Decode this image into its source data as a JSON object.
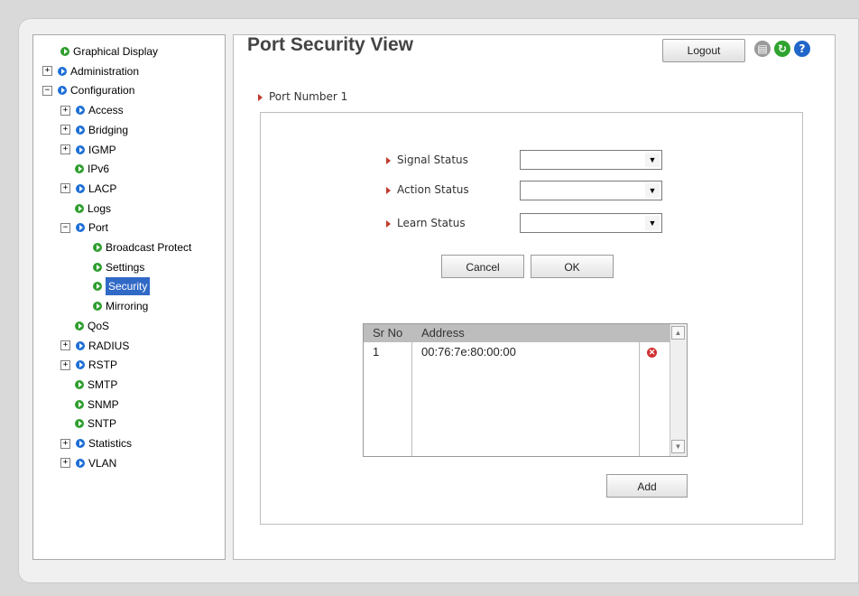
{
  "header": {
    "title": "Port Security View",
    "logout_label": "Logout",
    "save_glyph": "▤",
    "refresh_glyph": "↻",
    "help_glyph": "?"
  },
  "sidebar": {
    "items": [
      {
        "label": "Graphical Display",
        "expander": "",
        "bullet": "green"
      },
      {
        "label": "Administration",
        "expander": "+",
        "bullet": "blue"
      },
      {
        "label": "Configuration",
        "expander": "−",
        "bullet": "blue"
      },
      {
        "label": "Access",
        "expander": "+",
        "bullet": "blue"
      },
      {
        "label": "Bridging",
        "expander": "+",
        "bullet": "blue"
      },
      {
        "label": "IGMP",
        "expander": "+",
        "bullet": "blue"
      },
      {
        "label": "IPv6",
        "expander": "",
        "bullet": "green"
      },
      {
        "label": "LACP",
        "expander": "+",
        "bullet": "blue"
      },
      {
        "label": "Logs",
        "expander": "",
        "bullet": "green"
      },
      {
        "label": "Port",
        "expander": "−",
        "bullet": "blue"
      },
      {
        "label": "Broadcast Protect",
        "expander": "",
        "bullet": "green"
      },
      {
        "label": "Settings",
        "expander": "",
        "bullet": "green"
      },
      {
        "label": "Security",
        "expander": "",
        "bullet": "green",
        "selected": true
      },
      {
        "label": "Mirroring",
        "expander": "",
        "bullet": "green"
      },
      {
        "label": "QoS",
        "expander": "",
        "bullet": "green"
      },
      {
        "label": "RADIUS",
        "expander": "+",
        "bullet": "blue"
      },
      {
        "label": "RSTP",
        "expander": "+",
        "bullet": "blue"
      },
      {
        "label": "SMTP",
        "expander": "",
        "bullet": "green"
      },
      {
        "label": "SNMP",
        "expander": "",
        "bullet": "green"
      },
      {
        "label": "SNTP",
        "expander": "",
        "bullet": "green"
      },
      {
        "label": "Statistics",
        "expander": "+",
        "bullet": "blue"
      },
      {
        "label": "VLAN",
        "expander": "+",
        "bullet": "blue"
      }
    ]
  },
  "form": {
    "port_label": "Port Number 1",
    "signal_status_label": "Signal Status",
    "signal_status_value": "",
    "action_status_label": "Action Status",
    "action_status_value": "",
    "learn_status_label": "Learn Status",
    "learn_status_value": "",
    "dropdown_glyph": "▼",
    "cancel_label": "Cancel",
    "ok_label": "OK",
    "add_label": "Add"
  },
  "table": {
    "columns": [
      "Sr No",
      "Address"
    ],
    "rows": [
      {
        "sr_no": "1",
        "address": "00:76:7e:80:00:00",
        "delete_glyph": "✕"
      }
    ],
    "scroll_up_glyph": "▲",
    "scroll_down_glyph": "▼"
  },
  "colors": {
    "selected_bg": "#3169c6",
    "green_bullet": "#2f9e2f",
    "blue_bullet": "#1d6fd6",
    "arrow": "#c0392b",
    "delete": "#d23030"
  }
}
